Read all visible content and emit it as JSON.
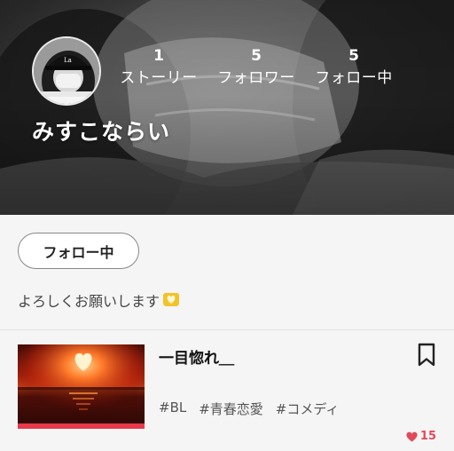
{
  "profile": {
    "username": "みすこならい",
    "stats": [
      {
        "value": "1",
        "label": "ストーリー"
      },
      {
        "value": "5",
        "label": "フォロワー"
      },
      {
        "value": "5",
        "label": "フォロー中"
      }
    ],
    "follow_button_label": "フォロー中",
    "bio": "よろしくお願いします"
  },
  "story": {
    "title": "一目惚れ＿",
    "tags": [
      "#BL",
      "#青春恋愛",
      "#コメディ"
    ],
    "likes": "15"
  },
  "colors": {
    "accent_red": "#e8394a",
    "like_red": "#e24a5a",
    "bio_heart": "#f2c229"
  },
  "icons": {
    "bookmark": "bookmark-icon",
    "like": "heart-icon",
    "bio_emoji": "heart-hands-icon"
  }
}
